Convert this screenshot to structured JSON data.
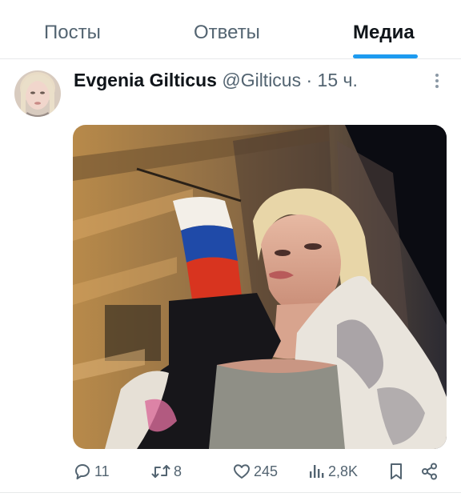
{
  "tabs": [
    {
      "label": "Посты"
    },
    {
      "label": "Ответы"
    },
    {
      "label": "Медиа"
    }
  ],
  "active_tab": "Медиа",
  "accent_color": "#1d9bf0",
  "tweet": {
    "author_name": "Evgenia Gilticus",
    "handle": "@Gilticus",
    "separator": "·",
    "time": "15 ч.",
    "media": {
      "description": "selfie photo"
    },
    "actions": {
      "replies": "11",
      "retweets": "8",
      "likes": "245",
      "views": "2,8K"
    }
  },
  "icons": [
    "more-icon",
    "reply-icon",
    "retweet-icon",
    "like-icon",
    "views-icon",
    "bookmark-icon",
    "share-icon"
  ]
}
